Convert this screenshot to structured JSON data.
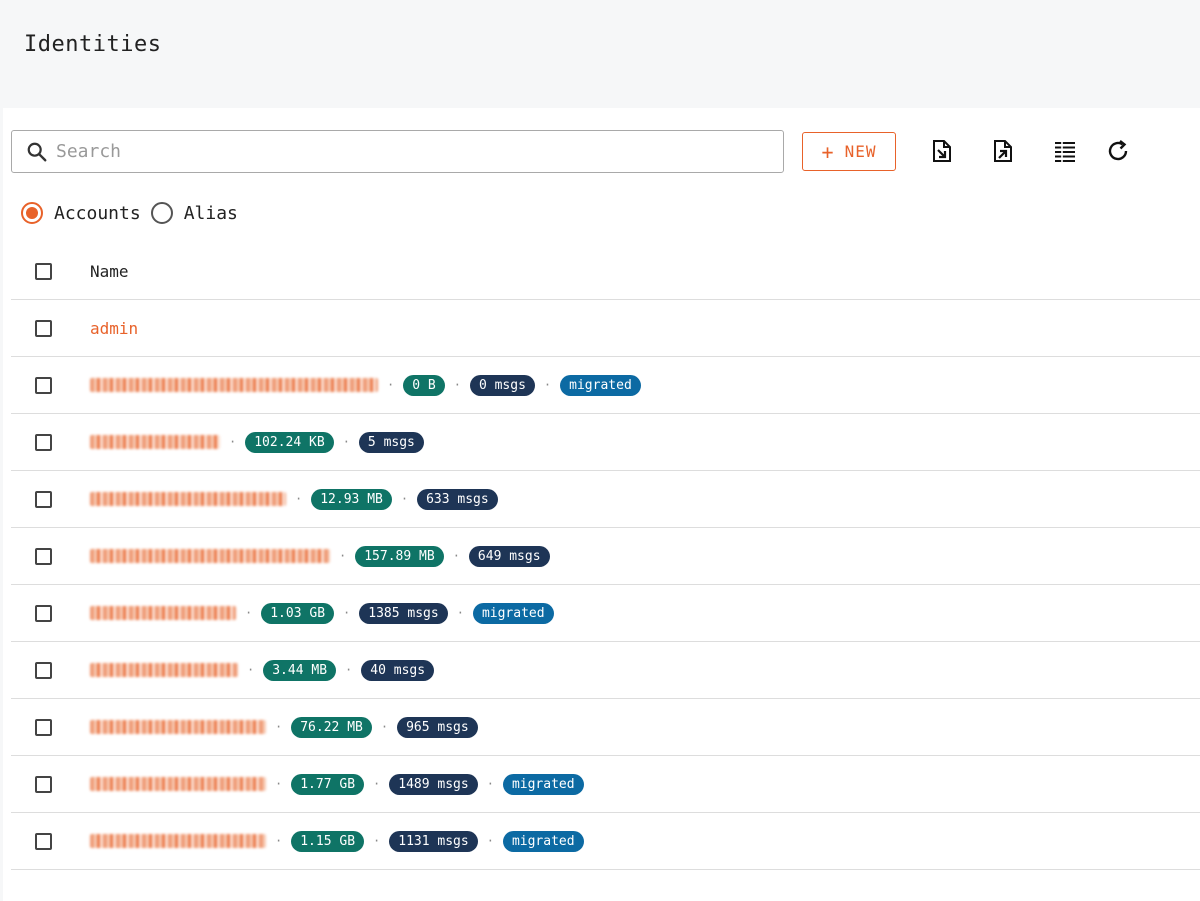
{
  "page": {
    "title": "Identities"
  },
  "toolbar": {
    "search_placeholder": "Search",
    "new_label": "NEW",
    "new_plus": "+"
  },
  "filters": {
    "options": [
      {
        "label": "Accounts",
        "selected": true
      },
      {
        "label": "Alias",
        "selected": false
      }
    ]
  },
  "table": {
    "header": {
      "name": "Name"
    },
    "rows": [
      {
        "name": "admin",
        "blurred": false,
        "size": "",
        "msgs": "",
        "migrated": ""
      },
      {
        "name": "",
        "blurred": true,
        "blur_len": "long",
        "size": "0 B",
        "msgs": "0 msgs",
        "migrated": "migrated"
      },
      {
        "name": "",
        "blurred": true,
        "blur_len": "med",
        "size": "102.24 KB",
        "msgs": "5 msgs",
        "migrated": ""
      },
      {
        "name": "",
        "blurred": true,
        "blur_len": "medlong",
        "size": "12.93 MB",
        "msgs": "633 msgs",
        "migrated": ""
      },
      {
        "name": "",
        "blurred": true,
        "blur_len": "xlong",
        "size": "157.89 MB",
        "msgs": "649 msgs",
        "migrated": ""
      },
      {
        "name": "",
        "blurred": true,
        "blur_len": "short",
        "size": "1.03 GB",
        "msgs": "1385 msgs",
        "migrated": "migrated"
      },
      {
        "name": "",
        "blurred": true,
        "blur_len": "shortmed",
        "size": "3.44 MB",
        "msgs": "40 msgs",
        "migrated": ""
      },
      {
        "name": "",
        "blurred": true,
        "blur_len": "med2",
        "size": "76.22 MB",
        "msgs": "965 msgs",
        "migrated": ""
      },
      {
        "name": "",
        "blurred": true,
        "blur_len": "med2",
        "size": "1.77 GB",
        "msgs": "1489 msgs",
        "migrated": "migrated"
      },
      {
        "name": "",
        "blurred": true,
        "blur_len": "med2",
        "size": "1.15 GB",
        "msgs": "1131 msgs",
        "migrated": "migrated"
      }
    ]
  },
  "colors": {
    "accent": "#e8622a",
    "size_badge": "#0f7466",
    "msgs_badge": "#1e3556",
    "migrated_badge": "#0c6aa3"
  }
}
